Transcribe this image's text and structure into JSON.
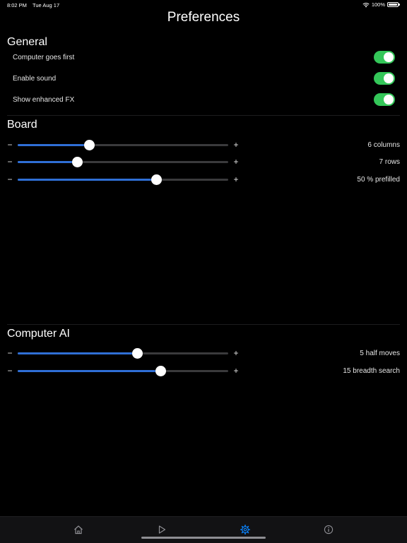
{
  "status_bar": {
    "time": "8:02 PM",
    "date": "Tue Aug 17",
    "battery": "100%",
    "wifi_icon": "wifi-icon",
    "battery_icon": "battery-icon"
  },
  "page": {
    "title": "Preferences"
  },
  "general": {
    "title": "General",
    "toggles": [
      {
        "label": "Computer goes first",
        "on": true
      },
      {
        "label": "Enable sound",
        "on": true
      },
      {
        "label": "Show enhanced FX",
        "on": true
      }
    ]
  },
  "board": {
    "title": "Board",
    "sliders": [
      {
        "value_label": "6 columns",
        "fraction": 0.34
      },
      {
        "value_label": "7 rows",
        "fraction": 0.285
      },
      {
        "value_label": "50 % prefilled",
        "fraction": 0.66
      }
    ]
  },
  "computer_ai": {
    "title": "Computer AI",
    "sliders": [
      {
        "value_label": "5 half moves",
        "fraction": 0.57
      },
      {
        "value_label": "15 breadth search",
        "fraction": 0.68
      }
    ]
  },
  "slider_glyphs": {
    "minus": "−",
    "plus": "+"
  },
  "tab_bar": {
    "items": [
      {
        "icon": "home-icon",
        "active": false
      },
      {
        "icon": "play-icon",
        "active": false
      },
      {
        "icon": "gear-icon",
        "active": true
      },
      {
        "icon": "info-icon",
        "active": false
      }
    ]
  },
  "colors": {
    "background": "#000000",
    "toggle_on": "#34c759",
    "slider_fill": "#2f6fd6",
    "slider_track": "#3a3a3c",
    "tab_active": "#0a84ff",
    "tab_inactive": "#8e8e93"
  }
}
